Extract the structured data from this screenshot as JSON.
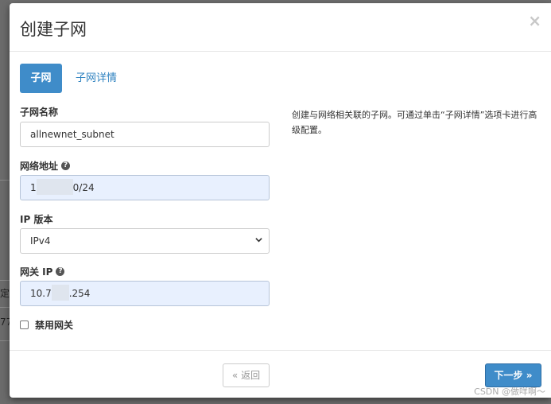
{
  "background": {
    "fragment_1": "定",
    "fragment_2": "77"
  },
  "modal": {
    "title": "创建子网",
    "close_symbol": "×"
  },
  "tabs": [
    {
      "label": "子网",
      "active": true
    },
    {
      "label": "子网详情",
      "active": false
    }
  ],
  "form": {
    "subnet_name": {
      "label": "子网名称",
      "value": "allnewnet_subnet"
    },
    "network_address": {
      "label": "网络地址",
      "value_prefix": "1",
      "value_suffix": "0/24",
      "help_icon": "question-icon"
    },
    "ip_version": {
      "label": "IP 版本",
      "selected": "IPv4"
    },
    "gateway_ip": {
      "label": "网关 IP",
      "value_prefix": "10.7",
      "value_suffix": ".254",
      "help_icon": "question-icon"
    },
    "disable_gateway": {
      "label": "禁用网关",
      "checked": false
    }
  },
  "help_text": "创建与网络相关联的子网。可通过单击“子网详情”选项卡进行高级配置。",
  "footer": {
    "back_label": "« 返回",
    "next_label": "下一步 »"
  },
  "watermark": "CSDN @做咩啊～",
  "colors": {
    "primary": "#3f8cc9",
    "link": "#2e82c0",
    "autofill": "#e8f0fe"
  }
}
